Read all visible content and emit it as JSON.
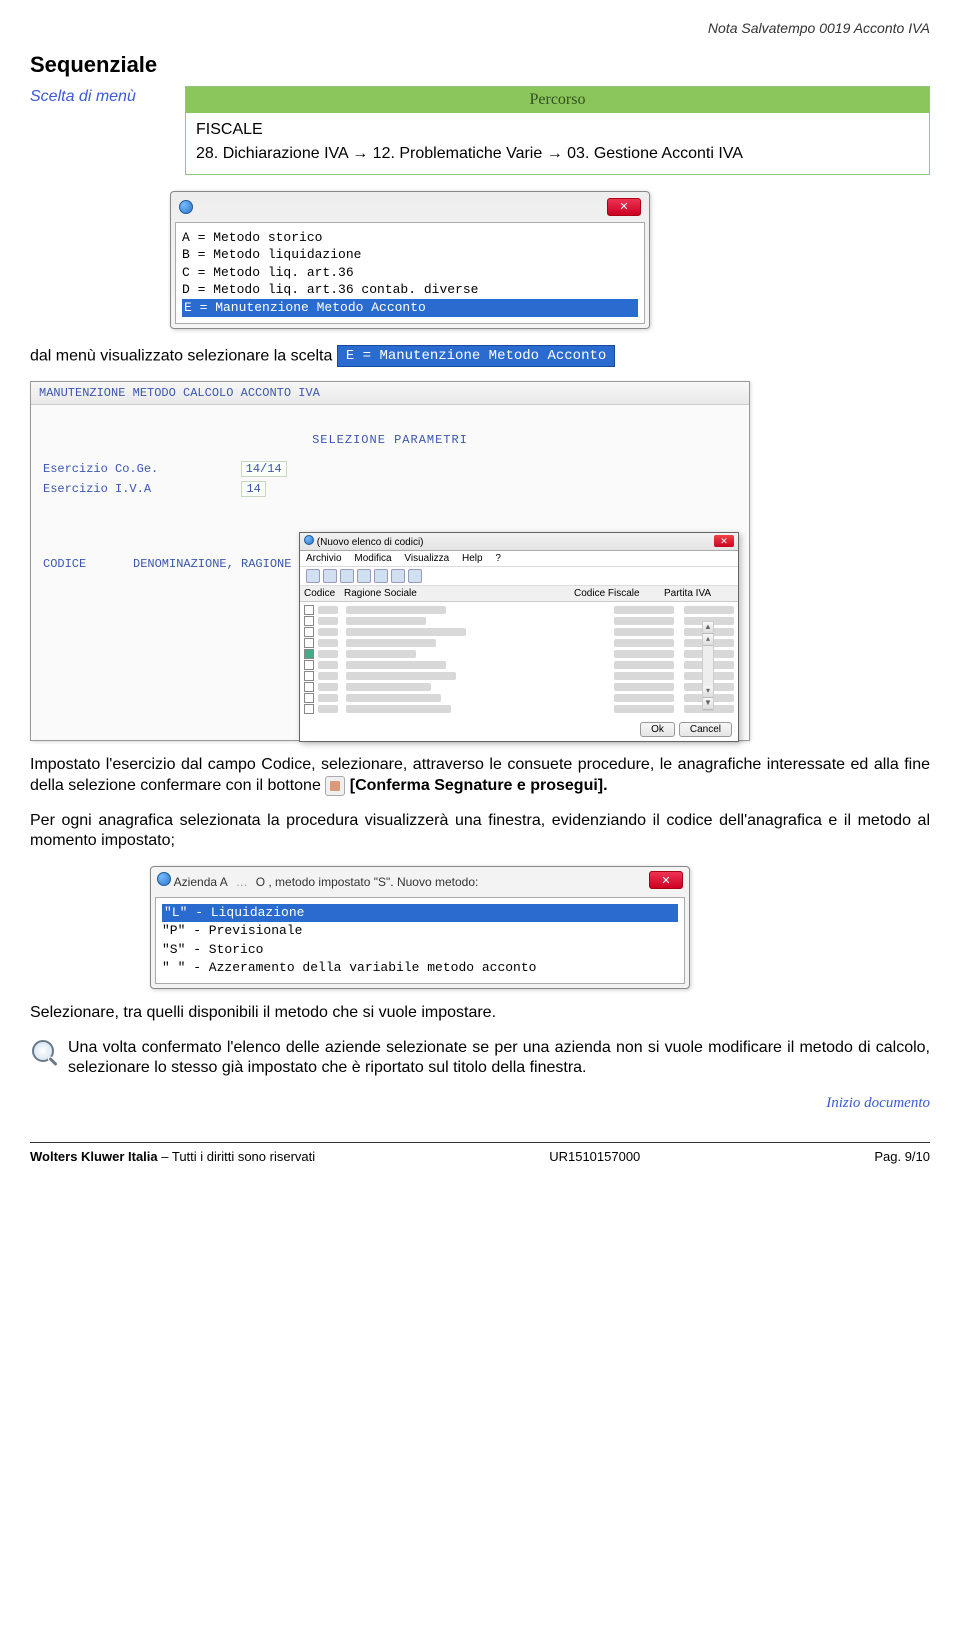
{
  "header_note": "Nota Salvatempo  0019 Acconto IVA",
  "title": "Sequenziale",
  "menu_label": "Scelta di menù",
  "percorso": {
    "header": "Percorso",
    "line1": "FISCALE",
    "line2": "28. Dichiarazione IVA → 12. Problematiche Varie → 03. Gestione Acconti IVA"
  },
  "options_dialog": {
    "a": "A = Metodo storico",
    "b": "B = Metodo liquidazione",
    "c": "C = Metodo liq. art.36",
    "d": "D = Metodo liq. art.36 contab. diverse",
    "e": "E = Manutenzione Metodo Acconto"
  },
  "sel_intro": "dal menù visualizzato selezionare la scelta",
  "sel_chip": "E  =  Manutenzione Metodo Acconto",
  "gray": {
    "title": "MANUTENZIONE METODO CALCOLO ACCONTO IVA",
    "section": "SELEZIONE PARAMETRI",
    "row1_label": "Esercizio Co.Ge.",
    "row1_val": "14/14",
    "row2_label": "Esercizio I.V.A",
    "row2_val": "14",
    "codice_label": "CODICE",
    "denom_label": "DENOMINAZIONE, RAGIONE SOCIALE O C"
  },
  "inner": {
    "title": "(Nuovo elenco di codici)",
    "menu": {
      "archivio": "Archivio",
      "modifica": "Modifica",
      "visualizza": "Visualizza",
      "help": "Help",
      "q": "?"
    },
    "cols": {
      "c1": "Codice",
      "c2": "Ragione Sociale",
      "c3": "Codice Fiscale",
      "c4": "Partita IVA"
    },
    "ok": "Ok",
    "cancel": "Cancel"
  },
  "para2_pre": "Impostato l'esercizio dal campo Codice, selezionare, attraverso le consuete procedure, le anagrafiche interessate ed alla fine della selezione confermare con il bottone ",
  "para2_bold": " [Conferma Segnature e prosegui].",
  "para2b": "Per ogni anagrafica selezionata la procedura visualizzerà una finestra, evidenziando il codice dell'anagrafica e il metodo al momento impostato;",
  "dialog2": {
    "title_prefix": "Azienda A",
    "title_suffix": "O , metodo impostato \"S\". Nuovo metodo:",
    "l": "\"L\" - Liquidazione",
    "p": "\"P\" - Previsionale",
    "s": "\"S\" - Storico",
    "blank": "\" \" - Azzeramento della variabile metodo acconto"
  },
  "para3": "Selezionare, tra quelli disponibili il metodo che si vuole impostare.",
  "note": "Una volta confermato l'elenco delle aziende selezionate se per una azienda non si vuole modificare il metodo di calcolo, selezionare lo stesso già impostato che è riportato sul titolo della finestra.",
  "link": "Inizio documento",
  "footer": {
    "left_bold": "Wolters Kluwer Italia",
    "left_rest": " – Tutti i diritti sono riservati",
    "center": "UR1510157000",
    "right": "Pag. 9/10"
  }
}
